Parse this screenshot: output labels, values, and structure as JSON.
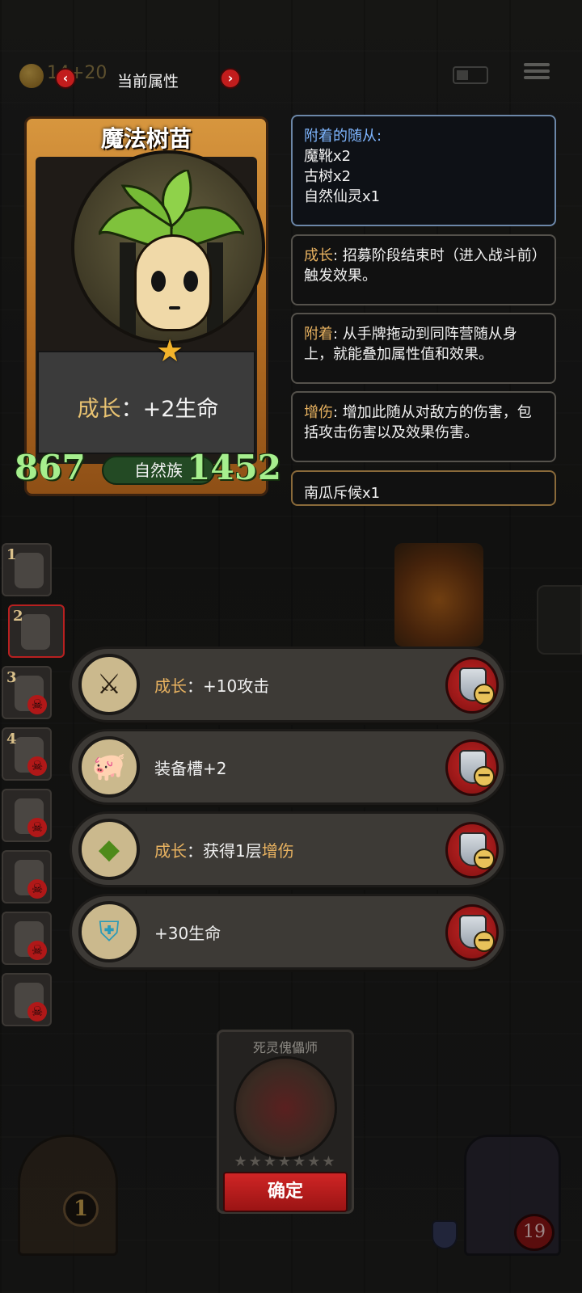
{
  "topbar": {
    "gold_text": "14+20",
    "title": "当前属性",
    "prev_icon": "chevron-left-icon",
    "next_icon": "chevron-right-icon",
    "prev_glyph": "‹",
    "next_glyph": "›"
  },
  "card": {
    "name": "魔法树苗",
    "desc_keyword": "成长",
    "desc_sep": "：",
    "desc_value": "+2生命",
    "attack": "867",
    "tribe": "自然族",
    "health": "1452",
    "star_glyph": "★",
    "stat_color": "#a6ef8e",
    "frame_color": "#d7963e"
  },
  "panels": {
    "attached_header": "附着的随从:",
    "attached_items": [
      "魔靴x2",
      "古树x2",
      "自然仙灵x1"
    ],
    "growth_keyword": "成长",
    "growth_text": ": 招募阶段结束时（进入战斗前）触发效果。",
    "attach_keyword": "附着",
    "attach_text": ": 从手牌拖动到同阵营随从身上，就能叠加属性值和效果。",
    "boost_keyword": "增伤",
    "boost_text": ": 增加此随从对敌方的伤害，包括攻击伤害以及效果伤害。",
    "pumpkin": "南瓜斥候x1",
    "keyword_color": "#e8b260"
  },
  "lineup": {
    "slots": [
      {
        "num": "1",
        "dead": false,
        "active": false
      },
      {
        "num": "2",
        "dead": false,
        "active": true
      },
      {
        "num": "3",
        "dead": true,
        "active": false
      },
      {
        "num": "4",
        "dead": true,
        "active": false
      },
      {
        "num": "",
        "dead": true,
        "active": false
      },
      {
        "num": "",
        "dead": true,
        "active": false
      },
      {
        "num": "",
        "dead": true,
        "active": false
      },
      {
        "num": "",
        "dead": true,
        "active": false
      }
    ],
    "skull_glyph": "☠"
  },
  "equipment": [
    {
      "icon": "axe-icon",
      "glyph": "⚔",
      "keyword": "成长",
      "text": "：+10攻击",
      "tail_kw": ""
    },
    {
      "icon": "pig-icon",
      "glyph": "🐖",
      "keyword": "",
      "text": "装备槽+2",
      "tail_kw": ""
    },
    {
      "icon": "crystal-icon",
      "glyph": "◆",
      "keyword": "成长",
      "text": "：获得1层",
      "tail_kw": "增伤"
    },
    {
      "icon": "shield-emblem-icon",
      "glyph": "⛨",
      "keyword": "",
      "text": "+30生命",
      "tail_kw": ""
    }
  ],
  "remove_glyph": "−",
  "bottom": {
    "hero_name": "死灵傀儡师",
    "hero_stars": "★★★★★★★",
    "confirm": "确定",
    "door_count": "1",
    "boss_hp": "19"
  }
}
